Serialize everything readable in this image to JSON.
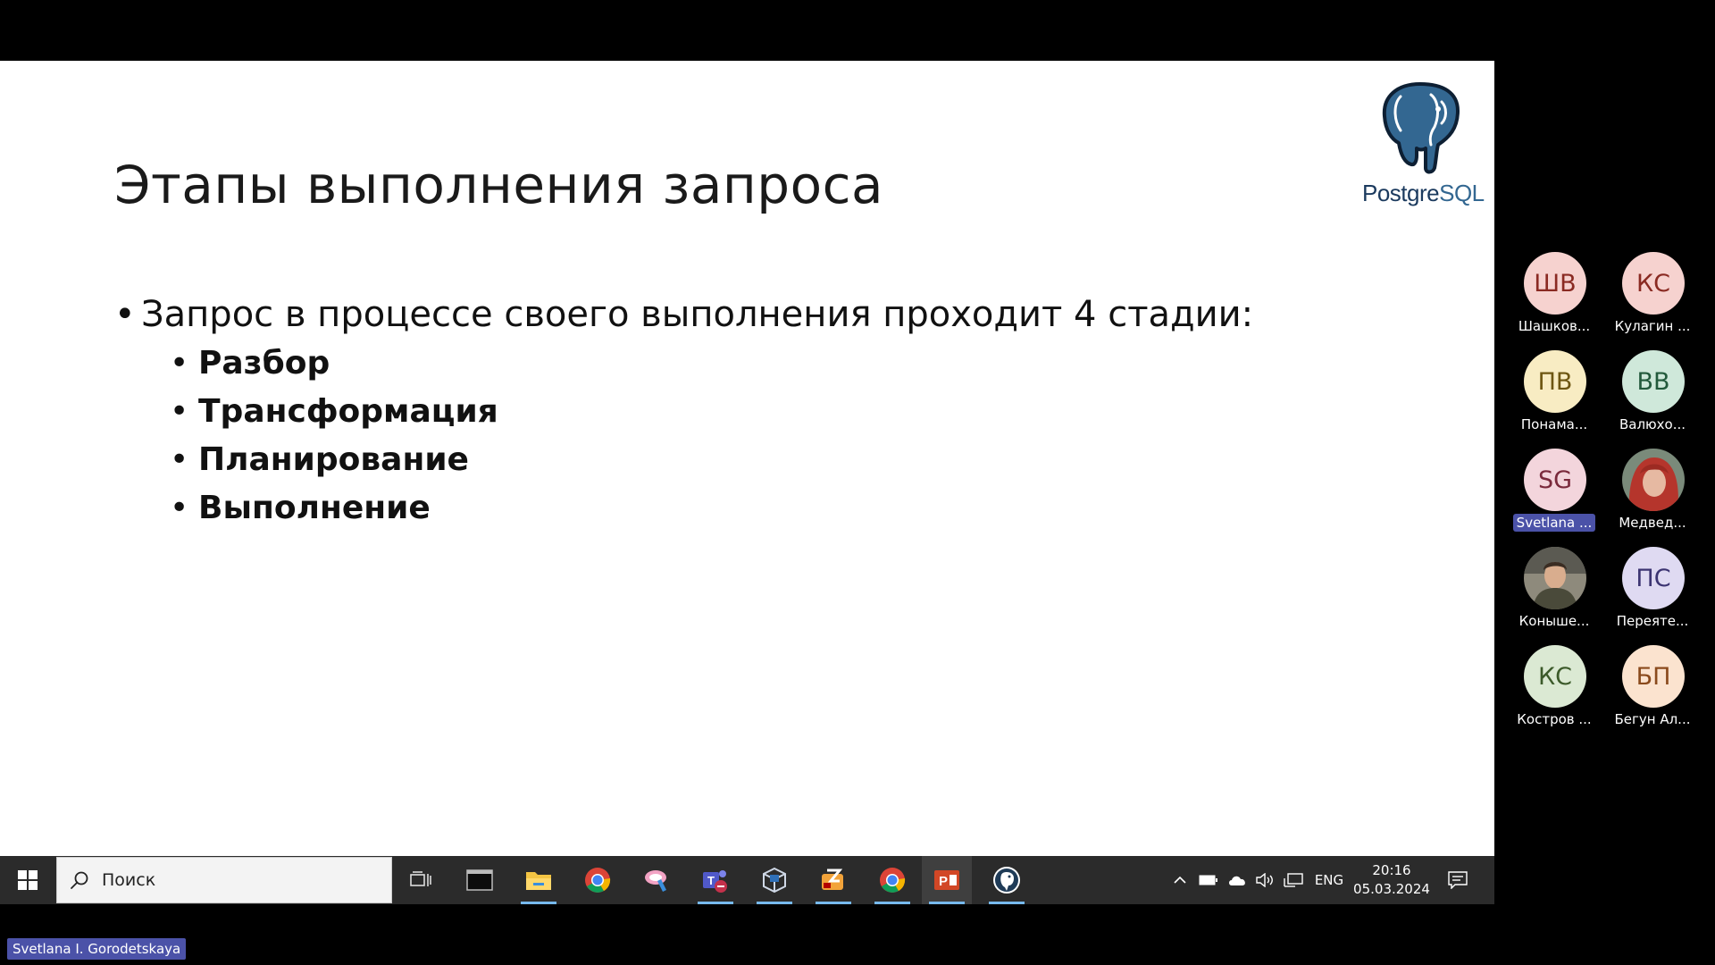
{
  "slide": {
    "title": "Этапы выполнения запроса",
    "logo_text_part1": "Postgre",
    "logo_text_part2": "SQL",
    "main_bullet": "Запрос в процессе своего выполнения проходит 4 стадии:",
    "sub_bullets": [
      "Разбор",
      "Трансформация",
      "Планирование",
      "Выполнение"
    ]
  },
  "taskbar": {
    "search_placeholder": "Поиск",
    "apps": [
      "task-view",
      "terminal",
      "file-explorer",
      "chrome",
      "paint-3d",
      "teams",
      "virtualbox",
      "filezilla",
      "chrome",
      "powerpoint",
      "pgadmin"
    ],
    "language": "ENG",
    "time": "20:16",
    "date": "05.03.2024"
  },
  "participants": [
    {
      "initials": "ШВ",
      "name": "Шашков...",
      "bg": "#f6d2cf",
      "fg": "#8a2a22"
    },
    {
      "initials": "КС",
      "name": "Кулагин ...",
      "bg": "#f6d2cf",
      "fg": "#8a2a22"
    },
    {
      "initials": "ПВ",
      "name": "Понама...",
      "bg": "#f8ecc3",
      "fg": "#6d5612"
    },
    {
      "initials": "ВВ",
      "name": "Валюхо...",
      "bg": "#cfe8da",
      "fg": "#235a3c"
    },
    {
      "initials": "SG",
      "name": "Svetlana ...",
      "bg": "#f3d5dc",
      "fg": "#7a2a3c"
    },
    {
      "initials": "",
      "name": "Медвед...",
      "bg": "#a84a3c",
      "fg": "#ffffff"
    },
    {
      "initials": "",
      "name": "Коныше...",
      "bg": "#6b6552",
      "fg": "#ffffff"
    },
    {
      "initials": "ПС",
      "name": "Переяте...",
      "bg": "#dfdaf2",
      "fg": "#3c3472"
    },
    {
      "initials": "КС",
      "name": "Костров ...",
      "bg": "#dbe9d3",
      "fg": "#3c5a2a"
    },
    {
      "initials": "БП",
      "name": "Бегун Ал...",
      "bg": "#fbe3cf",
      "fg": "#8a4a1c"
    }
  ],
  "active_speaker": "Svetlana I. Gorodetskaya"
}
